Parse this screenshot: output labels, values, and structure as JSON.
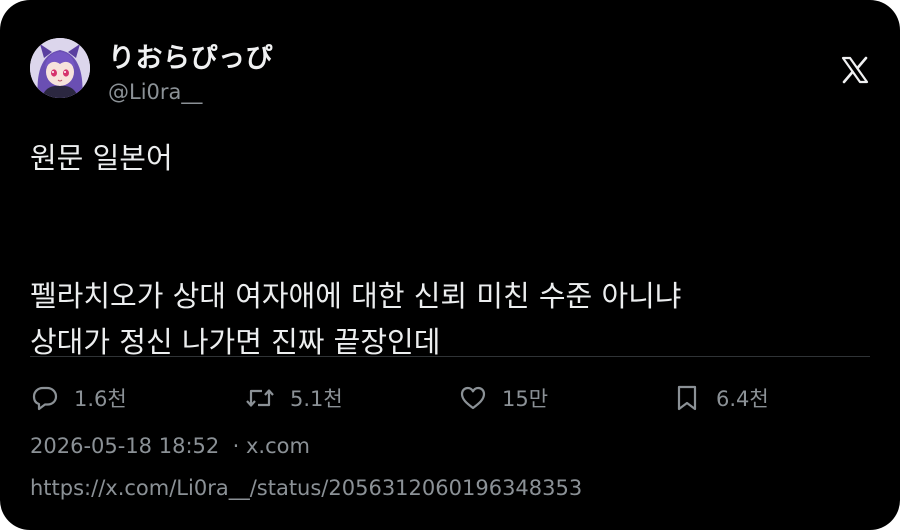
{
  "author": {
    "display_name": "りおらぴっぴ",
    "handle": "@Li0ra__",
    "avatar": "anime-character-avatar"
  },
  "brand_icon": "x-logo-icon",
  "tweet": {
    "lines": [
      "원문 일본어",
      "",
      "",
      "펠라치오가 상대 여자애에 대한 신뢰 미친 수준 아니냐",
      "상대가 정신 나가면 진짜 끝장인데"
    ]
  },
  "actions": {
    "replies": "1.6천",
    "retweets": "5.1천",
    "likes": "15만",
    "bookmarks": "6.4천"
  },
  "meta": {
    "timestamp": "2026-05-18 18:52",
    "separator": "·",
    "source": "x.com",
    "url": "https://x.com/Li0ra__/status/2056312060196348353"
  },
  "colors": {
    "background": "#000000",
    "text": "#e7e9ea",
    "muted": "#8b9196",
    "divider": "#2f3336"
  }
}
